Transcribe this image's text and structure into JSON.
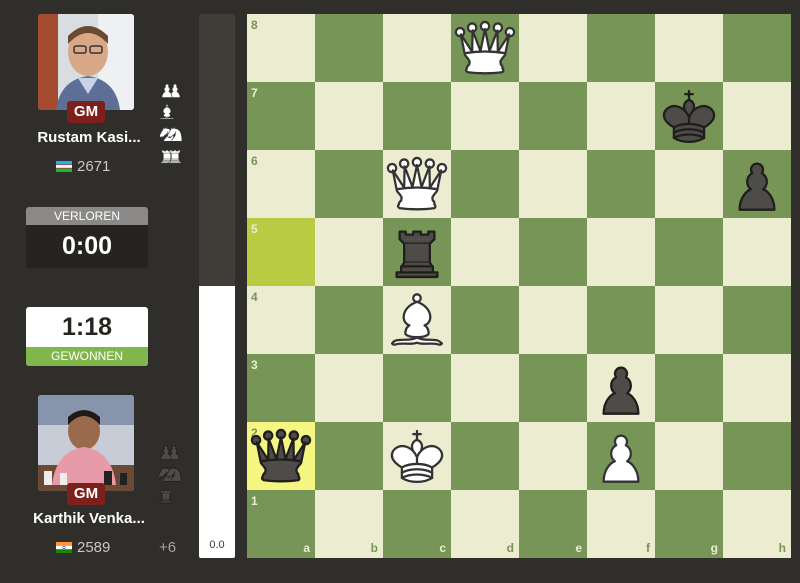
{
  "players": {
    "top": {
      "name": "Rustam Kasi...",
      "title": "GM",
      "rating": "2671",
      "flag": "uzbekistan-flag",
      "captured": [
        "white-pawn",
        "white-pawn",
        "white-pawn",
        "white-pawn",
        "white-pawn",
        "white-pawn",
        "white-pawn",
        "white-bishop",
        "white-knight",
        "white-knight",
        "white-rook",
        "white-rook"
      ]
    },
    "bottom": {
      "name": "Karthik Venka...",
      "title": "GM",
      "rating": "2589",
      "flag": "india-flag",
      "advantage": "+6",
      "captured": [
        "black-pawn",
        "black-pawn",
        "black-pawn",
        "black-pawn",
        "black-pawn",
        "black-pawn",
        "black-pawn",
        "black-knight",
        "black-knight",
        "black-rook"
      ]
    }
  },
  "clocks": {
    "black": {
      "status": "VERLOREN",
      "time": "0:00"
    },
    "white": {
      "status": "GEWONNEN",
      "time": "1:18"
    }
  },
  "eval": {
    "text": "0.0",
    "white_fraction": 0.5
  },
  "board": {
    "ranks": [
      "8",
      "7",
      "6",
      "5",
      "4",
      "3",
      "2",
      "1"
    ],
    "files": [
      "a",
      "b",
      "c",
      "d",
      "e",
      "f",
      "g",
      "h"
    ],
    "highlighted": [
      "a5",
      "a2"
    ],
    "pieces": [
      {
        "square": "d8",
        "piece": "white-queen"
      },
      {
        "square": "g7",
        "piece": "black-king"
      },
      {
        "square": "c6",
        "piece": "white-queen"
      },
      {
        "square": "h6",
        "piece": "black-pawn"
      },
      {
        "square": "c5",
        "piece": "black-rook"
      },
      {
        "square": "c4",
        "piece": "white-bishop"
      },
      {
        "square": "f3",
        "piece": "black-pawn"
      },
      {
        "square": "a2",
        "piece": "black-queen"
      },
      {
        "square": "c2",
        "piece": "white-king"
      },
      {
        "square": "f2",
        "piece": "white-pawn"
      }
    ]
  },
  "colors": {
    "light": "#ebecd0",
    "dark": "#779556",
    "highlight_light": "#f5f682",
    "highlight_dark": "#b9ca43",
    "win": "#81b64c",
    "title_badge": "#7d1f1b"
  }
}
